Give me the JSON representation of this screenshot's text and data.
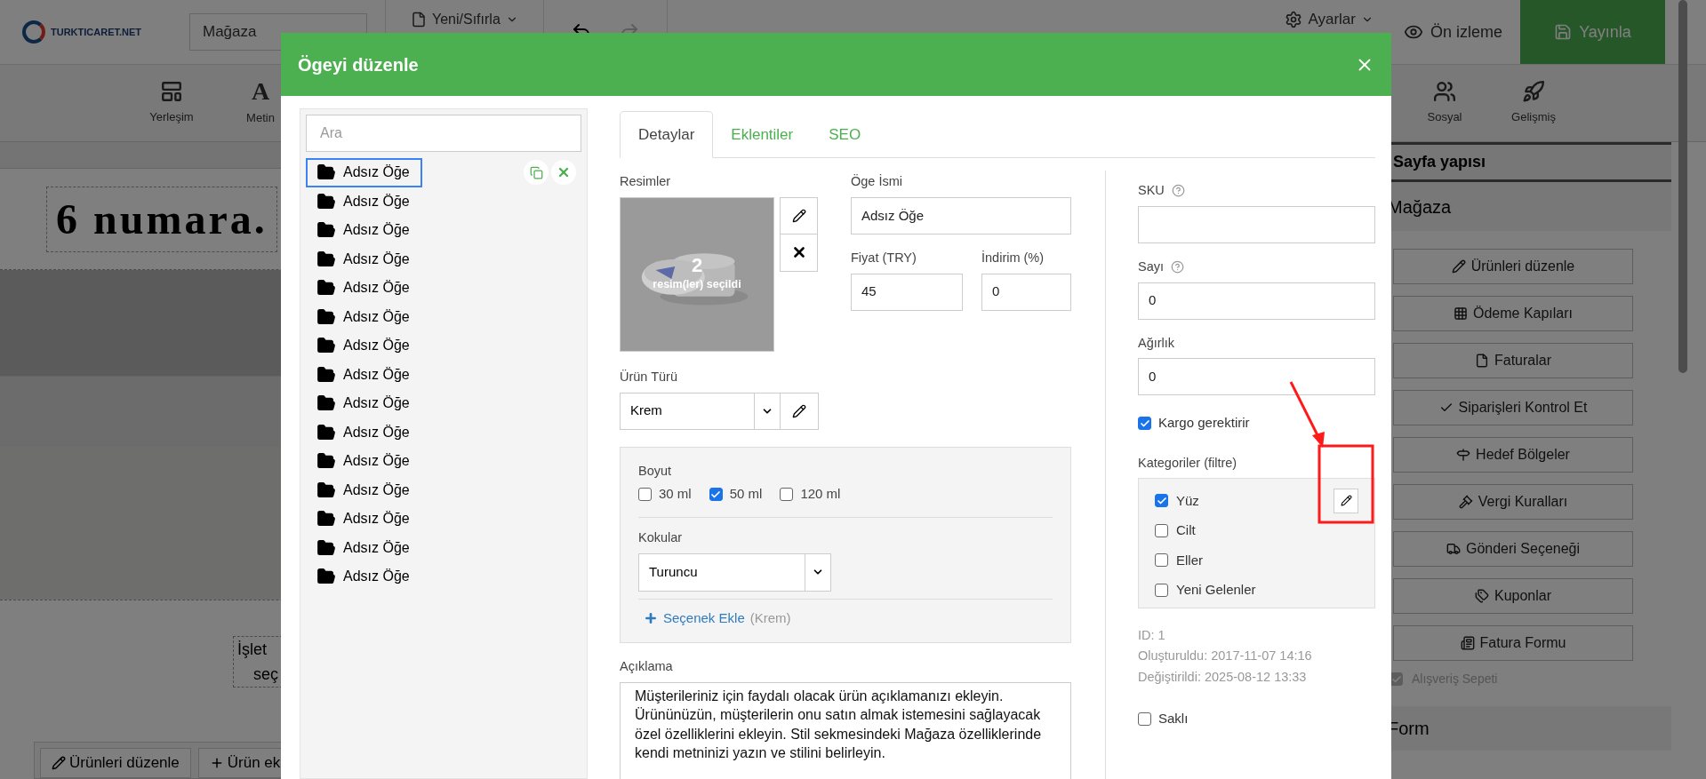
{
  "app": {
    "logo": "TURKTICARET.NET",
    "store_select": "Mağaza",
    "new_reset": "Yeni/Sıfırla",
    "settings": "Ayarlar",
    "preview": "Ön izleme",
    "publish": "Yayınla"
  },
  "toolbar": [
    {
      "kind": "layout",
      "label": "Yerleşim"
    },
    {
      "kind": "glyph",
      "glyph": "A",
      "label": "Metin"
    },
    {
      "kind": "social",
      "label": "Sosyal"
    },
    {
      "kind": "rocket",
      "label": "Gelişmiş"
    }
  ],
  "canvas": {
    "heading": "6 numara.",
    "text_lines": [
      "İşlet",
      "seç"
    ],
    "buttons": [
      {
        "kind": "pencil",
        "label": "Ürünleri düzenle"
      },
      {
        "kind": "plus",
        "label": "Ürün ek"
      }
    ]
  },
  "sidebar": {
    "title": "Sayfa yapısı",
    "section": "Mağaza",
    "buttons": [
      {
        "kind": "pencil",
        "label": "Ürünleri düzenle"
      },
      {
        "kind": "grid",
        "label": "Ödeme Kapıları"
      },
      {
        "kind": "file",
        "label": "Faturalar"
      },
      {
        "kind": "check",
        "label": "Siparişleri Kontrol Et"
      },
      {
        "kind": "signpost",
        "label": "Hedef Bölgeler"
      },
      {
        "kind": "gavel",
        "label": "Vergi Kuralları"
      },
      {
        "kind": "truck",
        "label": "Gönderi Seçeneği"
      },
      {
        "kind": "tags",
        "label": "Kuponlar"
      },
      {
        "kind": "form",
        "label": "Fatura Formu"
      }
    ],
    "cart": {
      "label": "Alışveriş Sepeti",
      "checked": true
    },
    "next_section": "Form"
  },
  "modal": {
    "title": "Ögeyi düzenle",
    "search": {
      "placeholder": "Ara"
    },
    "items": [
      {
        "label": "Adsız Öğe",
        "selected": true
      },
      {
        "label": "Adsız Öğe",
        "selected": false
      },
      {
        "label": "Adsız Öğe",
        "selected": false
      },
      {
        "label": "Adsız Öğe",
        "selected": false
      },
      {
        "label": "Adsız Öğe",
        "selected": false
      },
      {
        "label": "Adsız Öğe",
        "selected": false
      },
      {
        "label": "Adsız Öğe",
        "selected": false
      },
      {
        "label": "Adsız Öğe",
        "selected": false
      },
      {
        "label": "Adsız Öğe",
        "selected": false
      },
      {
        "label": "Adsız Öğe",
        "selected": false
      },
      {
        "label": "Adsız Öğe",
        "selected": false
      },
      {
        "label": "Adsız Öğe",
        "selected": false
      },
      {
        "label": "Adsız Öğe",
        "selected": false
      },
      {
        "label": "Adsız Öğe",
        "selected": false
      },
      {
        "label": "Adsız Öğe",
        "selected": false
      }
    ],
    "tabs": [
      {
        "label": "Detaylar",
        "selected": true
      },
      {
        "label": "Eklentiler",
        "selected": false
      },
      {
        "label": "SEO",
        "selected": false
      }
    ],
    "images": {
      "label": "Resimler",
      "count": "2",
      "caption": "resim(ler) seçildi"
    },
    "name": {
      "label": "Öge İsmi",
      "value": "Adsız Öğe"
    },
    "price": {
      "label": "Fiyat (TRY)",
      "value": "45"
    },
    "discount": {
      "label": "İndirim (%)",
      "value": "0"
    },
    "product_type": {
      "label": "Ürün Türü",
      "value": "Krem"
    },
    "size": {
      "label": "Boyut",
      "choices": [
        {
          "label": "30 ml",
          "checked": false
        },
        {
          "label": "50 ml",
          "checked": true
        },
        {
          "label": "120 ml",
          "checked": false
        }
      ]
    },
    "scent": {
      "label": "Kokular",
      "value": "Turuncu"
    },
    "add_option": {
      "label": "Seçenek Ekle",
      "note": "(Krem)"
    },
    "description": {
      "label": "Açıklama",
      "value": "Müşterileriniz için faydalı olacak ürün açıklamanızı ekleyin. Ürününüzün, müşterilerin onu satın almak istemesini sağlayacak özel özelliklerini ekleyin. Stil sekmesindeki Mağaza özelliklerinde kendi metninizi yazın ve stilini belirleyin."
    },
    "sku": {
      "label": "SKU"
    },
    "count": {
      "label": "Sayı",
      "value": "0"
    },
    "weight": {
      "label": "Ağırlık",
      "value": "0"
    },
    "shipping": {
      "label": "Kargo gerektirir",
      "checked": true
    },
    "categories": {
      "label": "Kategoriler (filtre)",
      "items": [
        {
          "label": "Yüz",
          "checked": true
        },
        {
          "label": "Cilt",
          "checked": false
        },
        {
          "label": "Eller",
          "checked": false
        },
        {
          "label": "Yeni Gelenler",
          "checked": false
        }
      ]
    },
    "meta": [
      "ID: 1",
      "Oluşturuldu: 2017-11-07 14:16",
      "Değiştirildi: 2025-08-12 13:33"
    ],
    "hidden": {
      "label": "Saklı",
      "checked": false
    }
  }
}
